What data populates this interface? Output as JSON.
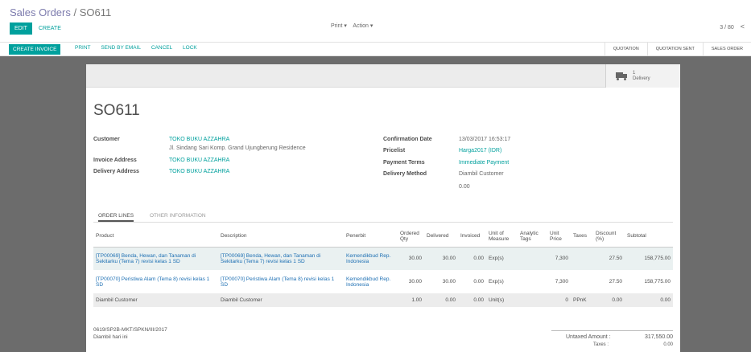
{
  "breadcrumb": {
    "parent": "Sales Orders",
    "separator": "/",
    "current": "SO611"
  },
  "toolbar": {
    "edit": "EDIT",
    "create": "CREATE",
    "print": "Print ▾",
    "action": "Action ▾",
    "pager": "3 / 80",
    "prev_icon": "chevron-left-icon",
    "prev_glyph": "<"
  },
  "statusbar": {
    "create_invoice": "CREATE INVOICE",
    "actions": [
      "PRINT",
      "SEND BY EMAIL",
      "CANCEL",
      "LOCK"
    ],
    "stages": [
      "QUOTATION",
      "QUOTATION SENT",
      "SALES ORDER"
    ]
  },
  "smart_button": {
    "count": "1",
    "label": "Delivery",
    "icon": "truck-icon"
  },
  "order": {
    "name": "SO611",
    "customer_label": "Customer",
    "customer": "TOKO BUKU AZZAHRA",
    "customer_address": "Jl. Sindang Sari Komp. Grand Ujungberung Residence",
    "invoice_address_label": "Invoice Address",
    "invoice_address": "TOKO BUKU AZZAHRA",
    "delivery_address_label": "Delivery Address",
    "delivery_address": "TOKO BUKU AZZAHRA",
    "confirmation_date_label": "Confirmation Date",
    "confirmation_date": "13/03/2017 16:53:17",
    "pricelist_label": "Pricelist",
    "pricelist": "Harga2017 (IDR)",
    "payment_terms_label": "Payment Terms",
    "payment_terms": "Immediate Payment",
    "delivery_method_label": "Delivery Method",
    "delivery_method": "Diambil Customer",
    "delivery_method_extra": "0.00"
  },
  "tabs": [
    "ORDER LINES",
    "OTHER INFORMATION"
  ],
  "table": {
    "headers": {
      "product": "Product",
      "description": "Description",
      "penerbit": "Penerbit",
      "ordered": "Ordered Qty",
      "delivered": "Delivered",
      "invoiced": "Invoiced",
      "uom": "Unit of Measure",
      "analytic": "Analytic Tags",
      "unit_price": "Unit Price",
      "taxes": "Taxes",
      "discount": "Discount (%)",
      "subtotal": "Subtotal"
    },
    "rows": [
      {
        "product": "[TP00069] Benda, Hewan, dan Tanaman di Sekitarku (Tema 7) revisi kelas 1 SD",
        "description": "[TP00069] Benda, Hewan, dan Tanaman di Sekitarku (Tema 7) revisi kelas 1 SD",
        "penerbit": "Kemendikbud Rep. Indonesia",
        "ordered": "30.00",
        "delivered": "30.00",
        "invoiced": "0.00",
        "uom": "Exp(s)",
        "analytic": "",
        "unit_price": "7,300",
        "taxes": "",
        "discount": "27.50",
        "subtotal": "158,775.00"
      },
      {
        "product": "[TP00070] Peristiwa Alam (Tema 8) revisi kelas 1 SD",
        "description": "[TP00070] Peristiwa Alam (Tema 8) revisi kelas 1 SD",
        "penerbit": "Kemendikbud Rep. Indonesia",
        "ordered": "30.00",
        "delivered": "30.00",
        "invoiced": "0.00",
        "uom": "Exp(s)",
        "analytic": "",
        "unit_price": "7,300",
        "taxes": "",
        "discount": "27.50",
        "subtotal": "158,775.00"
      },
      {
        "product": "Diambil Customer",
        "description": "Diambil Customer",
        "penerbit": "",
        "ordered": "1.00",
        "delivered": "0.00",
        "invoiced": "0.00",
        "uom": "Unit(s)",
        "analytic": "",
        "unit_price": "0",
        "taxes": "PPnK",
        "discount": "0.00",
        "subtotal": "0.00"
      }
    ]
  },
  "note": {
    "line1": "0619/SP2B-MKT/SPKN/III/2017",
    "line2": "Diambil hari ini"
  },
  "totals": {
    "untaxed_label": "Untaxed Amount :",
    "untaxed": "317,550.00",
    "taxes_label": "Taxes :",
    "taxes": "0.00"
  },
  "colors": {
    "primary": "#00a09d",
    "brand": "#7c7bad",
    "link": "#1d6fb3"
  }
}
